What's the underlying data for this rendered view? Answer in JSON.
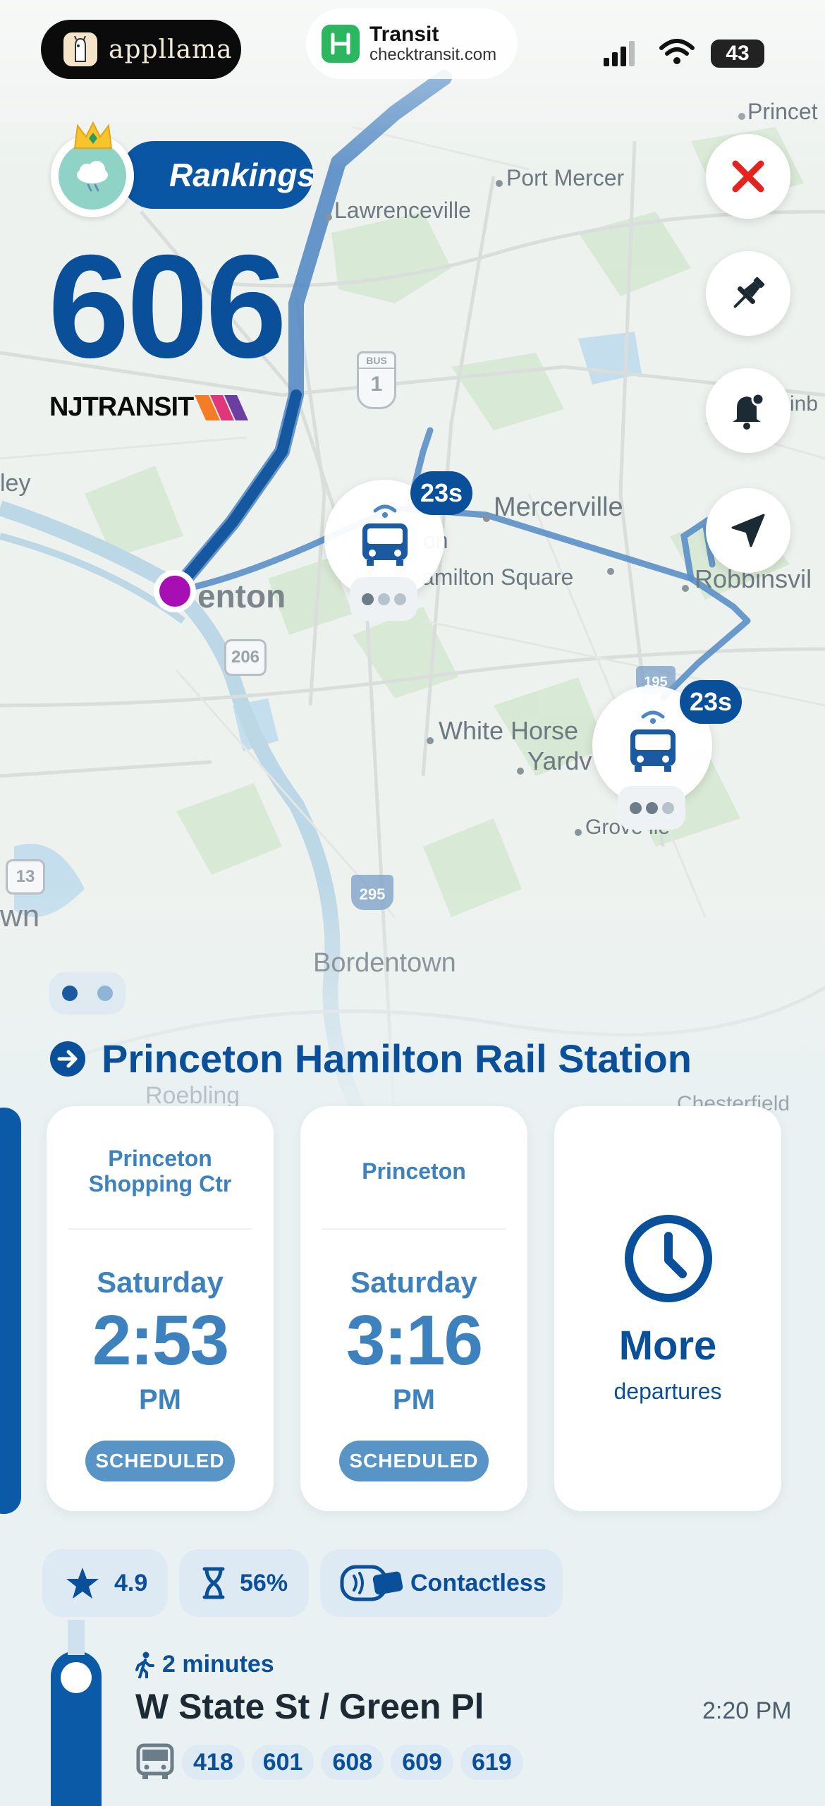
{
  "status_bar": {
    "app_pill_label": "appllama",
    "transit_title": "Transit",
    "transit_url": "checktransit.com",
    "battery": "43"
  },
  "map": {
    "labels": {
      "princeton": "Princet",
      "port_mercer": "Port Mercer",
      "lawrenceville": "Lawrenceville",
      "mercerville": "Mercerville",
      "trenton": "enton",
      "hamilton_square": "amilton Square",
      "robbinsville": "Robbinsvil",
      "white_horse": "White Horse",
      "yardville": "Yardv",
      "groveville": "Grove  lle",
      "bordentown": "Bordentown",
      "roebling": "Roebling",
      "chesterfield": "Chesterfield",
      "ley": "ley",
      "wn": "wn",
      "inb": "inb",
      "on": "on"
    },
    "shields": {
      "us1_top": "BUS",
      "us1": "1",
      "r206": "206",
      "r13": "13",
      "i195": "195",
      "i295": "295"
    },
    "vehicles": [
      {
        "badge": "23s"
      },
      {
        "badge": "23s"
      }
    ],
    "colors": {
      "route_line": "#3f7dbf",
      "route_line_dark": "#1b5aa0",
      "origin_dot": "#a70fb5"
    }
  },
  "rankings": {
    "label": "Rankings",
    "route_number": "606",
    "agency": "NJTRANSIT"
  },
  "station": {
    "name": "Princeton Hamilton Rail Station"
  },
  "departures": [
    {
      "destination": "Princeton Shopping Ctr",
      "day": "Saturday",
      "time": "2:53",
      "ampm": "PM",
      "status": "SCHEDULED"
    },
    {
      "destination": "Princeton",
      "day": "Saturday",
      "time": "3:16",
      "ampm": "PM",
      "status": "SCHEDULED"
    }
  ],
  "more_card": {
    "title": "More",
    "subtitle": "departures"
  },
  "chips": {
    "rating": "4.9",
    "crowding": "56%",
    "payment": "Contactless"
  },
  "nearby_stop": {
    "walk": "2 minutes",
    "name": "W State St / Green Pl",
    "time": "2:20 PM",
    "routes": [
      "418",
      "601",
      "608",
      "609",
      "619"
    ]
  },
  "accent": "#0a4f9a"
}
